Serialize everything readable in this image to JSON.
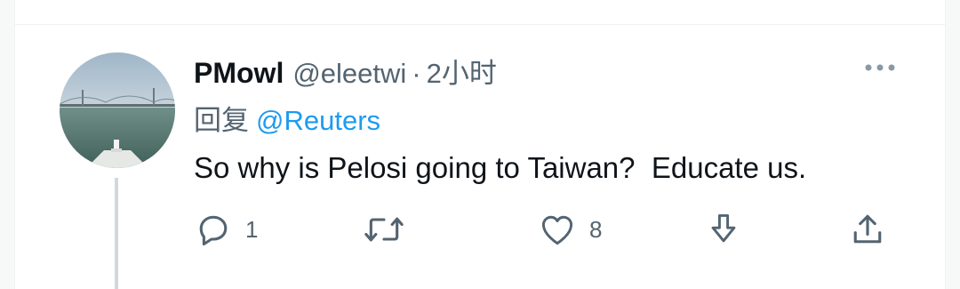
{
  "tweet": {
    "display_name": "PMowl",
    "handle": "@eleetwi",
    "separator": "·",
    "time": "2小时",
    "reply_prefix": "回复",
    "reply_mention": "@Reuters",
    "text": "So why is Pelosi going to Taiwan?  Educate us."
  },
  "actions": {
    "reply": {
      "icon": "reply-icon",
      "count": "1"
    },
    "retweet": {
      "icon": "retweet-icon",
      "count": ""
    },
    "like": {
      "icon": "heart-icon",
      "count": "8"
    },
    "bookmark": {
      "icon": "download-arrow-icon"
    },
    "share": {
      "icon": "share-icon"
    }
  },
  "colors": {
    "text": "#0f1419",
    "secondary": "#536471",
    "link": "#1d9bf0",
    "thread_line": "#cfd9de"
  }
}
